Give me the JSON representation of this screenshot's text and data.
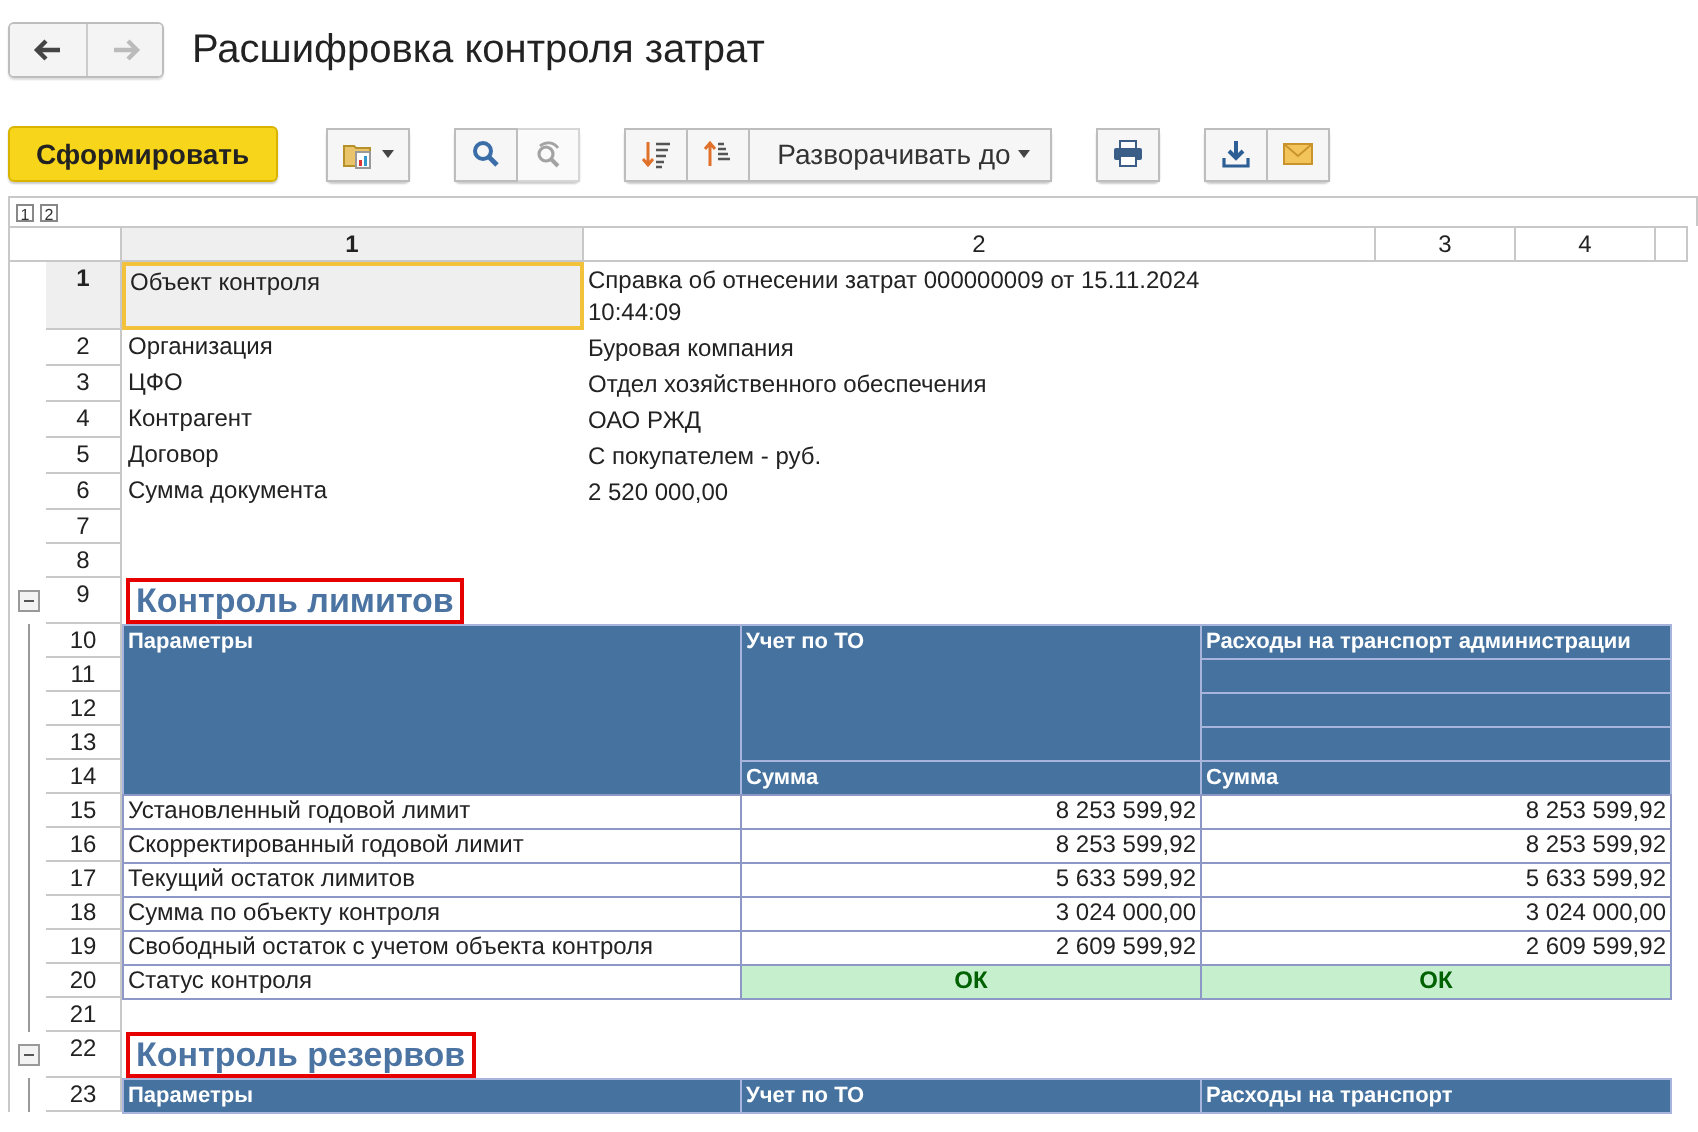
{
  "window": {
    "title": "Расшифровка контроля затрат"
  },
  "navigation": [
    {
      "kind": "back",
      "disabled": false
    },
    {
      "kind": "forward",
      "disabled": true
    }
  ],
  "toolbar": {
    "groups": [
      {
        "buttons": [
          {
            "kind": "primary",
            "label": "Сформировать",
            "disabled": false
          }
        ]
      },
      {
        "buttons": [
          {
            "kind": "settings-menu",
            "disabled": false
          }
        ]
      },
      {
        "buttons": [
          {
            "kind": "search",
            "disabled": false
          },
          {
            "kind": "search-next",
            "disabled": true
          }
        ]
      },
      {
        "buttons": [
          {
            "kind": "sort-down",
            "disabled": false
          },
          {
            "kind": "sort-up",
            "disabled": false
          },
          {
            "kind": "dropdown",
            "label": "Разворачивать до",
            "disabled": false
          }
        ]
      },
      {
        "buttons": [
          {
            "kind": "print",
            "disabled": false
          }
        ]
      },
      {
        "buttons": [
          {
            "kind": "save",
            "disabled": false
          },
          {
            "kind": "email",
            "disabled": false
          }
        ]
      }
    ]
  },
  "sheet": {
    "level_buttons": [
      "1",
      "2"
    ],
    "column_headers": [
      {
        "label": "1",
        "selected": true
      },
      {
        "label": "2",
        "selected": false
      },
      {
        "label": "3",
        "selected": false
      },
      {
        "label": "4",
        "selected": false
      }
    ],
    "rows": [
      {
        "kind": "field",
        "number": "1",
        "label": "Объект контроля",
        "value_lines": [
          "Справка об отнесении затрат 000000009 от 15.11.2024",
          "10:44:09"
        ],
        "selected": true
      },
      {
        "kind": "field",
        "number": "2",
        "label": "Организация",
        "value_lines": [
          "Буровая компания"
        ],
        "selected": false
      },
      {
        "kind": "field",
        "number": "3",
        "label": "ЦФО",
        "value_lines": [
          "Отдел хозяйственного обеспечения"
        ],
        "selected": false
      },
      {
        "kind": "field",
        "number": "4",
        "label": "Контрагент",
        "value_lines": [
          "ОАО РЖД"
        ],
        "selected": false
      },
      {
        "kind": "field",
        "number": "5",
        "label": "Договор",
        "value_lines": [
          "С покупателем - руб."
        ],
        "selected": false
      },
      {
        "kind": "field",
        "number": "6",
        "label": "Сумма документа",
        "value_lines": [
          "2 520 000,00"
        ],
        "selected": false
      },
      {
        "kind": "blank",
        "number": "7"
      },
      {
        "kind": "blank",
        "number": "8"
      },
      {
        "kind": "section_title",
        "number": "9",
        "title": "Контроль лимитов",
        "expanded": true
      },
      {
        "kind": "table_head",
        "numbers": [
          "10",
          "11",
          "12",
          "13",
          "14"
        ],
        "columns": [
          {
            "title": "Параметры"
          },
          {
            "title": "Учет по ТО",
            "subtitle": "Сумма"
          },
          {
            "title": "Расходы на транспорт администрации",
            "subtitle": "Сумма"
          }
        ]
      },
      {
        "kind": "table_row",
        "number": "15",
        "label": "Установленный годовой лимит",
        "values": [
          "8 253 599,92",
          "8 253 599,92"
        ]
      },
      {
        "kind": "table_row",
        "number": "16",
        "label": "Скорректированный годовой лимит",
        "values": [
          "8 253 599,92",
          "8 253 599,92"
        ]
      },
      {
        "kind": "table_row",
        "number": "17",
        "label": "Текущий остаток лимитов",
        "values": [
          "5 633 599,92",
          "5 633 599,92"
        ]
      },
      {
        "kind": "table_row",
        "number": "18",
        "label": "Сумма по объекту контроля",
        "values": [
          "3 024 000,00",
          "3 024 000,00"
        ]
      },
      {
        "kind": "table_row",
        "number": "19",
        "label": "Свободный остаток с учетом объекта контроля",
        "values": [
          "2 609 599,92",
          "2 609 599,92"
        ]
      },
      {
        "kind": "status_row",
        "number": "20",
        "label": "Статус контроля",
        "values": [
          {
            "text": "ОК",
            "ok": true
          },
          {
            "text": "ОК",
            "ok": true
          }
        ]
      },
      {
        "kind": "blank",
        "number": "21"
      },
      {
        "kind": "section_title",
        "number": "22",
        "title": "Контроль резервов",
        "expanded": true
      },
      {
        "kind": "table_head",
        "numbers": [
          "23"
        ],
        "columns": [
          {
            "title": "Параметры"
          },
          {
            "title": "Учет по ТО"
          },
          {
            "title": "Расходы на транспорт"
          }
        ]
      }
    ]
  }
}
